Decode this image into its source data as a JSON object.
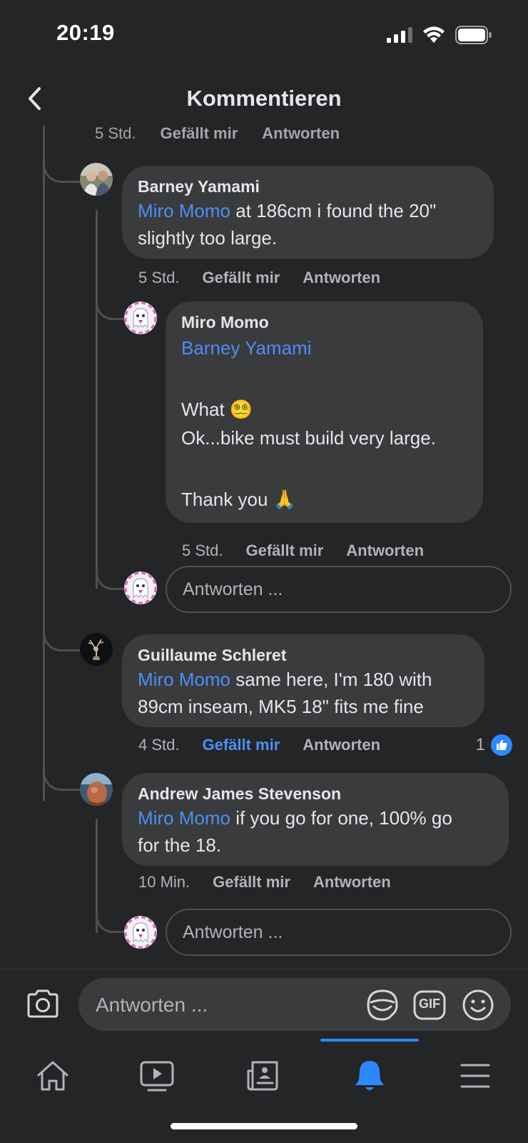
{
  "status_bar": {
    "time": "20:19"
  },
  "header": {
    "title": "Kommentieren",
    "back_icon": "chevron-left-icon"
  },
  "previous_comment_meta": {
    "time": "5 Std.",
    "like": "Gefällt mir",
    "reply": "Antworten"
  },
  "comments": [
    {
      "author": "Barney Yamami",
      "mention": "Miro Momo",
      "line1_rest": " at 186cm i found the 20\"",
      "line2": "slightly too large.",
      "time": "5 Std.",
      "like": "Gefällt mir",
      "reply": "Antworten"
    },
    {
      "author": "Miro Momo",
      "mention": "Barney Yamami",
      "line_what": "What",
      "emoji_what": "😵‍💫",
      "line_ok": "Ok...bike must build very large.",
      "line_thanks": "Thank you",
      "emoji_thanks": "🙏",
      "time": "5 Std.",
      "like": "Gefällt mir",
      "reply": "Antworten"
    },
    {
      "author": "Guillaume Schleret",
      "mention": "Miro Momo",
      "line1_rest": " same here, I'm 180 with",
      "line2": "89cm inseam, MK5 18\" fits me fine",
      "time": "4 Std.",
      "like": "Gefällt mir",
      "reply": "Antworten",
      "like_count": "1"
    },
    {
      "author": "Andrew James Stevenson",
      "mention": "Miro Momo",
      "line1_rest": " if you go for one, 100% go",
      "line2": "for the 18.",
      "time": "10 Min.",
      "like": "Gefällt mir",
      "reply": "Antworten"
    }
  ],
  "reply_inputs": [
    {
      "placeholder": "Antworten ..."
    },
    {
      "placeholder": "Antworten ..."
    }
  ],
  "composer": {
    "placeholder": "Antworten ...",
    "gif_label": "GIF"
  },
  "colors": {
    "background": "#242526",
    "bubble": "#3a3b3c",
    "mention": "#4c8ff7",
    "accent": "#2d88ff"
  },
  "tabs": [
    {
      "icon": "home-icon"
    },
    {
      "icon": "video-icon"
    },
    {
      "icon": "news-icon"
    },
    {
      "icon": "bell-icon",
      "active": true
    },
    {
      "icon": "menu-icon"
    }
  ]
}
